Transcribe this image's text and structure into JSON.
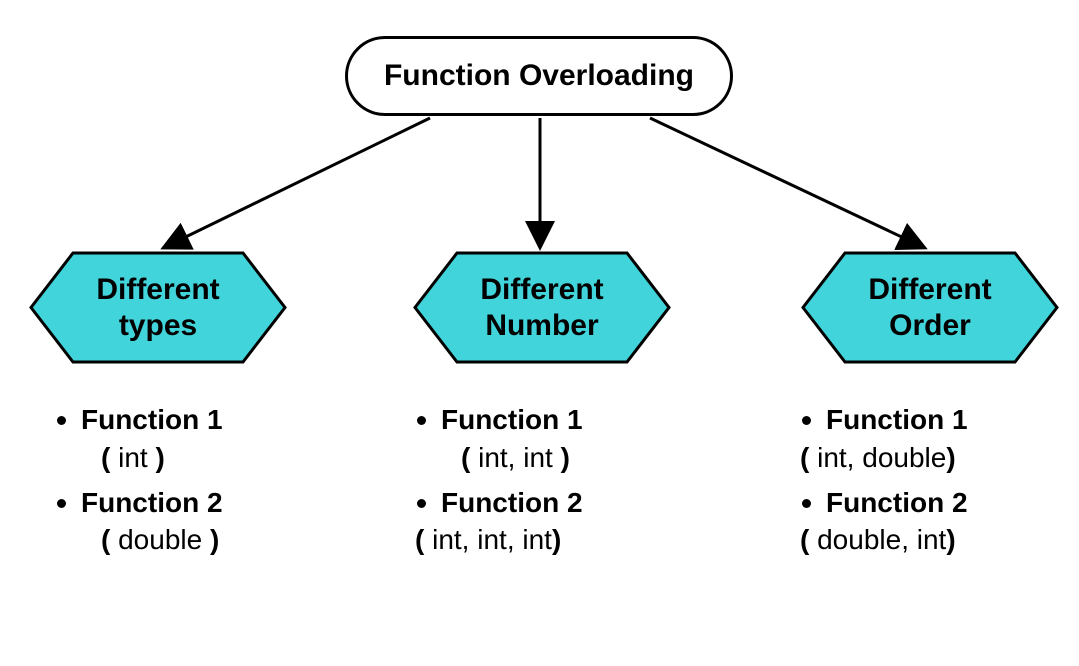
{
  "root": {
    "title": "Function Overloading"
  },
  "colors": {
    "hexFill": "#41d5db",
    "stroke": "#000"
  },
  "branches": [
    {
      "title": "Different\ntypes",
      "items": [
        {
          "name": "Function 1",
          "sig_open": "( ",
          "sig_mid": "int",
          "sig_close": " )"
        },
        {
          "name": "Function 2",
          "sig_open": "( ",
          "sig_mid": "double",
          "sig_close": " )"
        }
      ]
    },
    {
      "title": "Different\nNumber",
      "items": [
        {
          "name": "Function 1",
          "sig_open": "( ",
          "sig_mid": "int, int",
          "sig_close": " )"
        },
        {
          "name": "Function 2",
          "sig_open": "( ",
          "sig_mid": "int, int,  int",
          "sig_close": ")"
        }
      ]
    },
    {
      "title": "Different\nOrder",
      "items": [
        {
          "name": "Function 1",
          "sig_open": "( ",
          "sig_mid": "int, double",
          "sig_close": ")"
        },
        {
          "name": "Function 2",
          "sig_open": "( ",
          "sig_mid": "double, int",
          "sig_close": ")"
        }
      ]
    }
  ]
}
